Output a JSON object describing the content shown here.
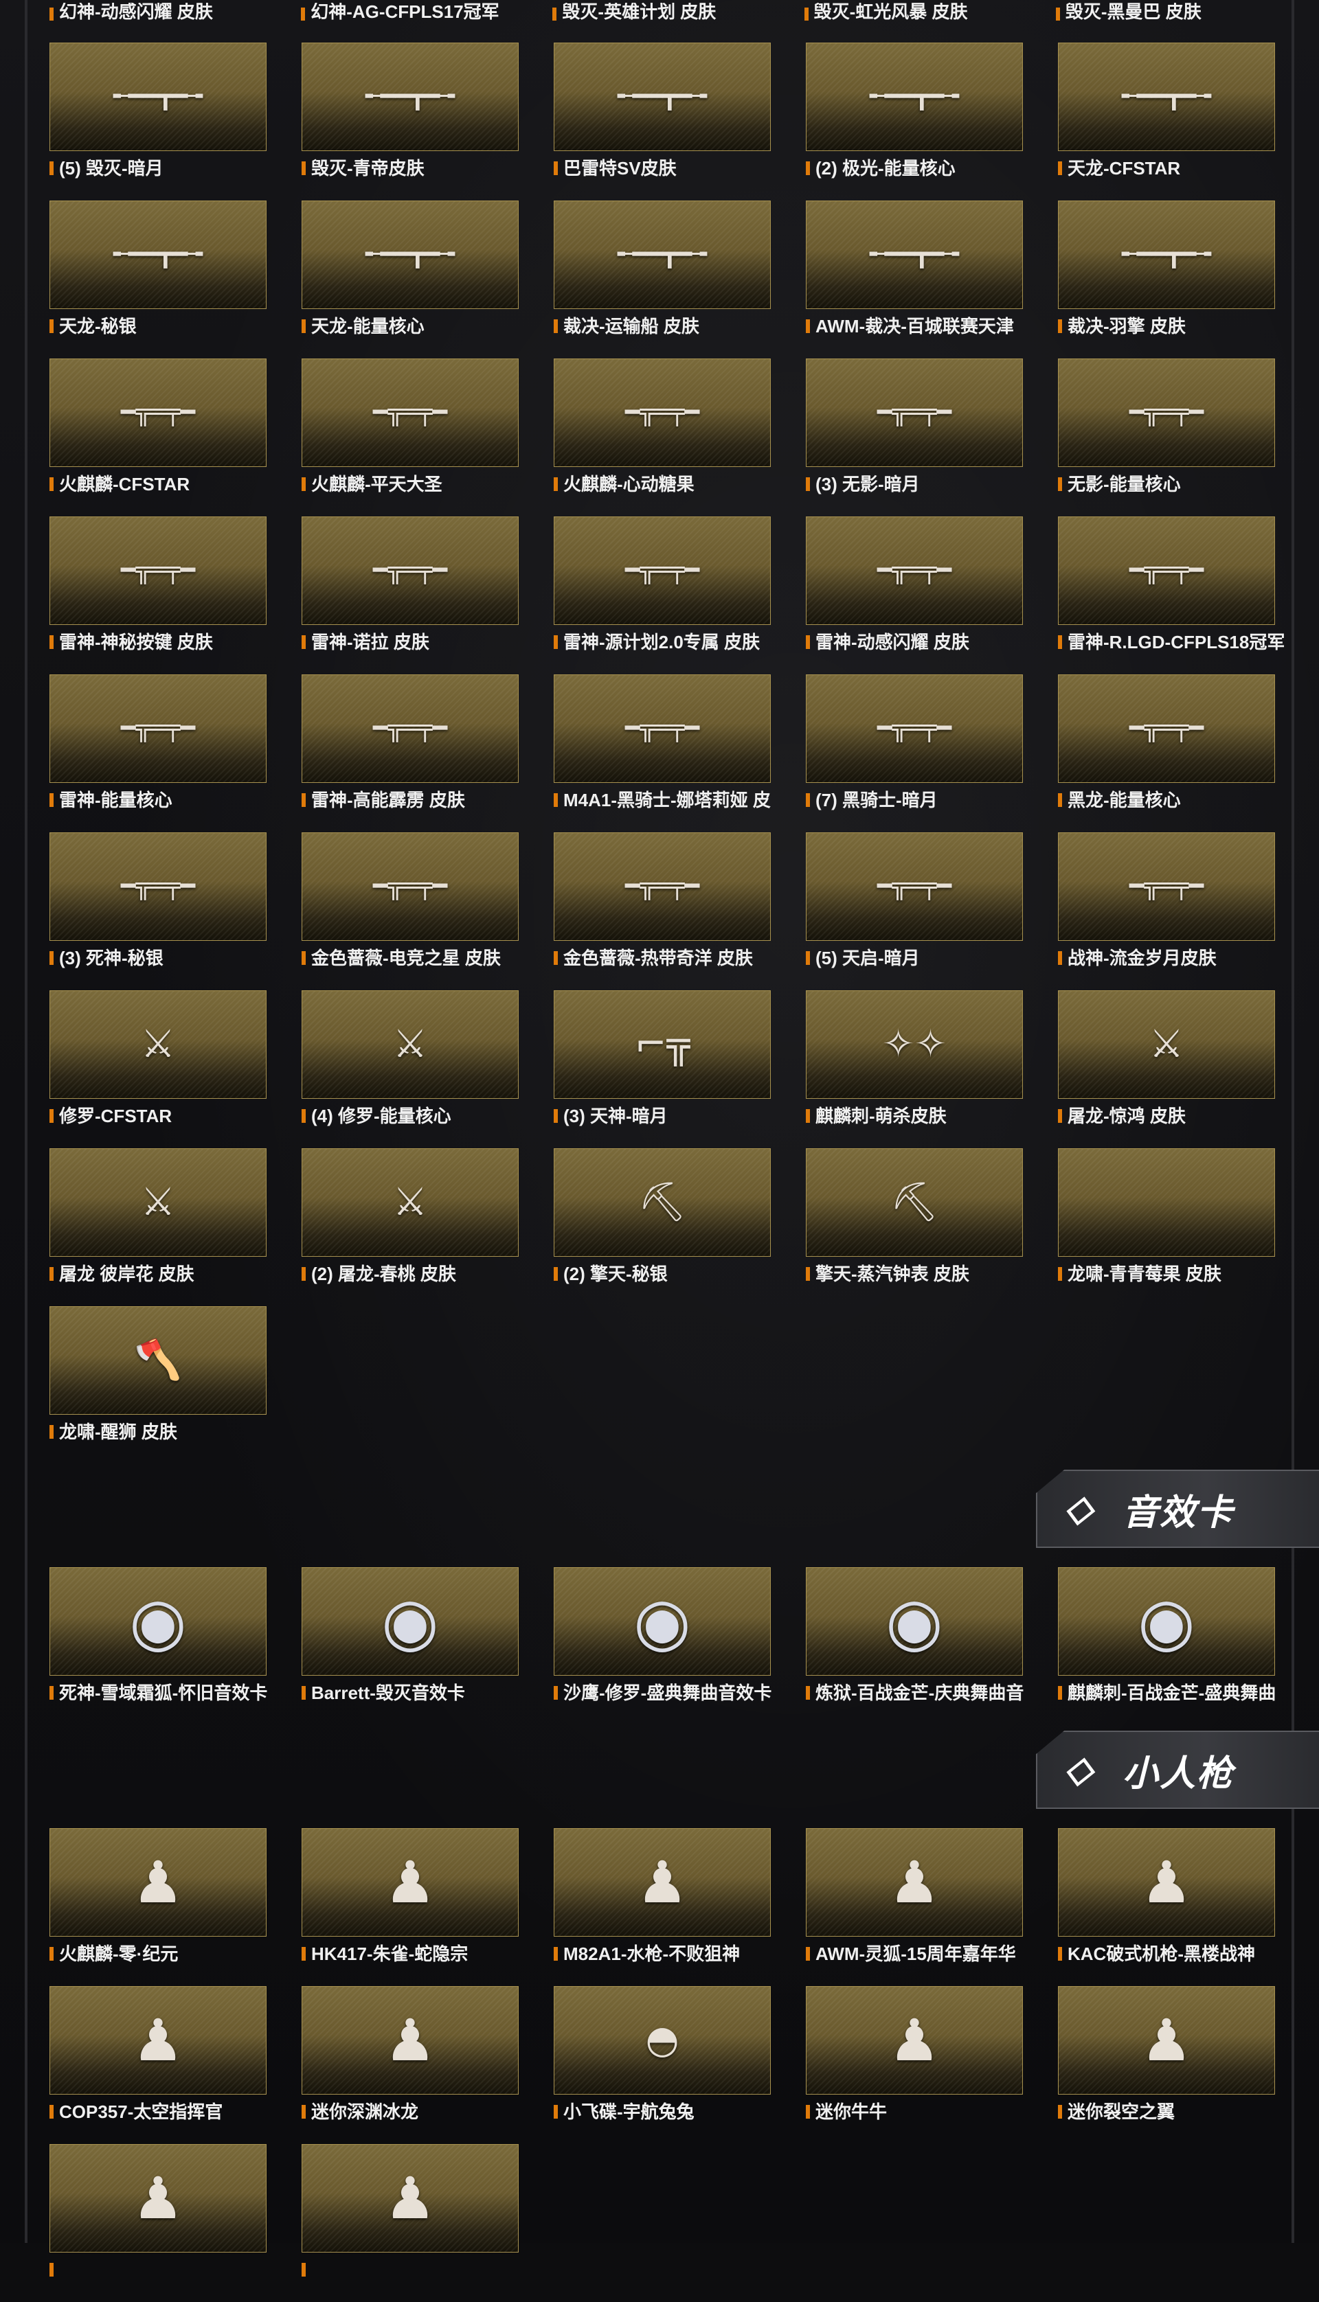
{
  "top_labels": [
    "幻神-动感闪耀 皮肤",
    "幻神-AG-CFPLS17冠军",
    "毁灭-英雄计划 皮肤",
    "毁灭-虹光风暴 皮肤",
    "毁灭-黑曼巴 皮肤"
  ],
  "weapon_rows": [
    [
      {
        "label": "(5) 毁灭-暗月",
        "icon": "sniper-rifle-icon"
      },
      {
        "label": "毁灭-青帝皮肤",
        "icon": "sniper-rifle-icon"
      },
      {
        "label": "巴雷特SV皮肤",
        "icon": "sniper-rifle-icon"
      },
      {
        "label": "(2) 极光-能量核心",
        "icon": "sniper-rifle-icon"
      },
      {
        "label": "天龙-CFSTAR",
        "icon": "sniper-rifle-icon"
      }
    ],
    [
      {
        "label": "天龙-秘银",
        "icon": "sniper-rifle-icon"
      },
      {
        "label": "天龙-能量核心",
        "icon": "sniper-rifle-icon"
      },
      {
        "label": "裁决-运输船 皮肤",
        "icon": "sniper-rifle-icon"
      },
      {
        "label": "AWM-裁决-百城联赛天津",
        "icon": "sniper-rifle-icon"
      },
      {
        "label": "裁决-羽擎 皮肤",
        "icon": "sniper-rifle-icon"
      }
    ],
    [
      {
        "label": "火麒麟-CFSTAR",
        "icon": "rifle-icon"
      },
      {
        "label": "火麒麟-平天大圣",
        "icon": "rifle-icon"
      },
      {
        "label": "火麒麟-心动糖果",
        "icon": "rifle-icon"
      },
      {
        "label": "(3) 无影-暗月",
        "icon": "rifle-icon"
      },
      {
        "label": "无影-能量核心",
        "icon": "rifle-icon"
      }
    ],
    [
      {
        "label": "雷神-神秘按键 皮肤",
        "icon": "rifle-icon"
      },
      {
        "label": "雷神-诺拉 皮肤",
        "icon": "rifle-icon"
      },
      {
        "label": "雷神-源计划2.0专属 皮肤",
        "icon": "rifle-icon"
      },
      {
        "label": "雷神-动感闪耀 皮肤",
        "icon": "rifle-icon"
      },
      {
        "label": "雷神-R.LGD-CFPLS18冠军",
        "icon": "rifle-icon"
      }
    ],
    [
      {
        "label": "雷神-能量核心",
        "icon": "rifle-icon"
      },
      {
        "label": "雷神-高能霹雳 皮肤",
        "icon": "rifle-icon"
      },
      {
        "label": "M4A1-黑骑士-娜塔莉娅 皮",
        "icon": "rifle-icon"
      },
      {
        "label": "(7) 黑骑士-暗月",
        "icon": "rifle-icon"
      },
      {
        "label": "黑龙-能量核心",
        "icon": "rifle-icon"
      }
    ],
    [
      {
        "label": "(3) 死神-秘银",
        "icon": "rifle-icon"
      },
      {
        "label": "金色蔷薇-电竞之星 皮肤",
        "icon": "rifle-icon"
      },
      {
        "label": "金色蔷薇-热带奇洋 皮肤",
        "icon": "rifle-icon"
      },
      {
        "label": "(5) 天启-暗月",
        "icon": "rifle-icon"
      },
      {
        "label": "战神-流金岁月皮肤",
        "icon": "rifle-icon"
      }
    ],
    [
      {
        "label": "修罗-CFSTAR",
        "icon": "blade-icon"
      },
      {
        "label": "(4) 修罗-能量核心",
        "icon": "blade-icon"
      },
      {
        "label": "(3) 天神-暗月",
        "icon": "pistol-icon"
      },
      {
        "label": "麒麟刺-萌杀皮肤",
        "icon": "claw-icon"
      },
      {
        "label": "屠龙-惊鸿 皮肤",
        "icon": "blade-icon"
      }
    ],
    [
      {
        "label": "屠龙 彼岸花 皮肤",
        "icon": "blade-icon"
      },
      {
        "label": "(2) 屠龙-春桃 皮肤",
        "icon": "blade-icon"
      },
      {
        "label": "(2) 擎天-秘银",
        "icon": "shovel-icon"
      },
      {
        "label": "擎天-蒸汽钟表 皮肤",
        "icon": "shovel-icon"
      },
      {
        "label": "龙啸-青青莓果 皮肤",
        "icon": "none"
      }
    ],
    [
      {
        "label": "龙啸-醒狮 皮肤",
        "icon": "axe-icon"
      }
    ]
  ],
  "section_sound": {
    "title": "音效卡",
    "items": [
      {
        "label": "死神-雪域霜狐-怀旧音效卡",
        "icon": "disc-icon"
      },
      {
        "label": "Barrett-毁灭音效卡",
        "icon": "disc-icon"
      },
      {
        "label": "沙鹰-修罗-盛典舞曲音效卡",
        "icon": "disc-icon"
      },
      {
        "label": "炼狱-百战金芒-庆典舞曲音",
        "icon": "disc-icon"
      },
      {
        "label": "麒麟刺-百战金芒-盛典舞曲",
        "icon": "disc-icon"
      }
    ]
  },
  "section_mini": {
    "title": "小人枪",
    "rows": [
      [
        {
          "label": "火麒麟-零·纪元",
          "icon": "figure-icon"
        },
        {
          "label": "HK417-朱雀-蛇隐宗",
          "icon": "figure-icon"
        },
        {
          "label": "M82A1-水枪-不败狙神",
          "icon": "figure-icon"
        },
        {
          "label": "AWM-灵狐-15周年嘉年华",
          "icon": "figure-icon"
        },
        {
          "label": "KAC破式机枪-黑楼战神",
          "icon": "figure-icon"
        }
      ],
      [
        {
          "label": "COP357-太空指挥官",
          "icon": "figure-icon"
        },
        {
          "label": "迷你深渊冰龙",
          "icon": "figure-icon"
        },
        {
          "label": "小飞碟-宇航兔兔",
          "icon": "ufo-icon"
        },
        {
          "label": "迷你牛牛",
          "icon": "figure-icon"
        },
        {
          "label": "迷你裂空之翼",
          "icon": "figure-icon"
        }
      ],
      [
        {
          "label": "",
          "icon": "figure-icon"
        },
        {
          "label": "",
          "icon": "figure-icon"
        }
      ]
    ]
  }
}
